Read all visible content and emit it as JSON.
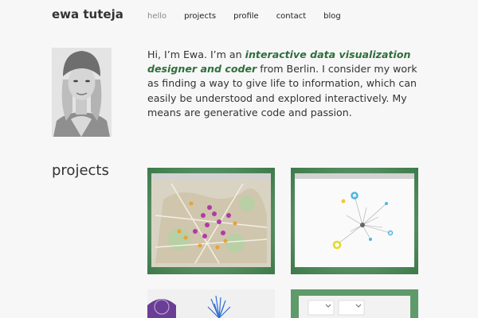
{
  "site": {
    "title": "ewa tuteja"
  },
  "nav": {
    "items": [
      "hello",
      "projects",
      "profile",
      "contact",
      "blog"
    ],
    "active": "hello"
  },
  "intro": {
    "part1": "Hi, I’m Ewa. I’m an ",
    "highlight": "interactive data visualization designer and coder",
    "part2": " from Berlin. I consider my work as finding a way to give life to information, which can easily be understood and explored interactively. My means are generative code and passion."
  },
  "projects": {
    "heading": "projects"
  },
  "colors": {
    "accent": "#2f6e3c",
    "thumb_frame": "#4c8a58",
    "text": "#333333"
  }
}
